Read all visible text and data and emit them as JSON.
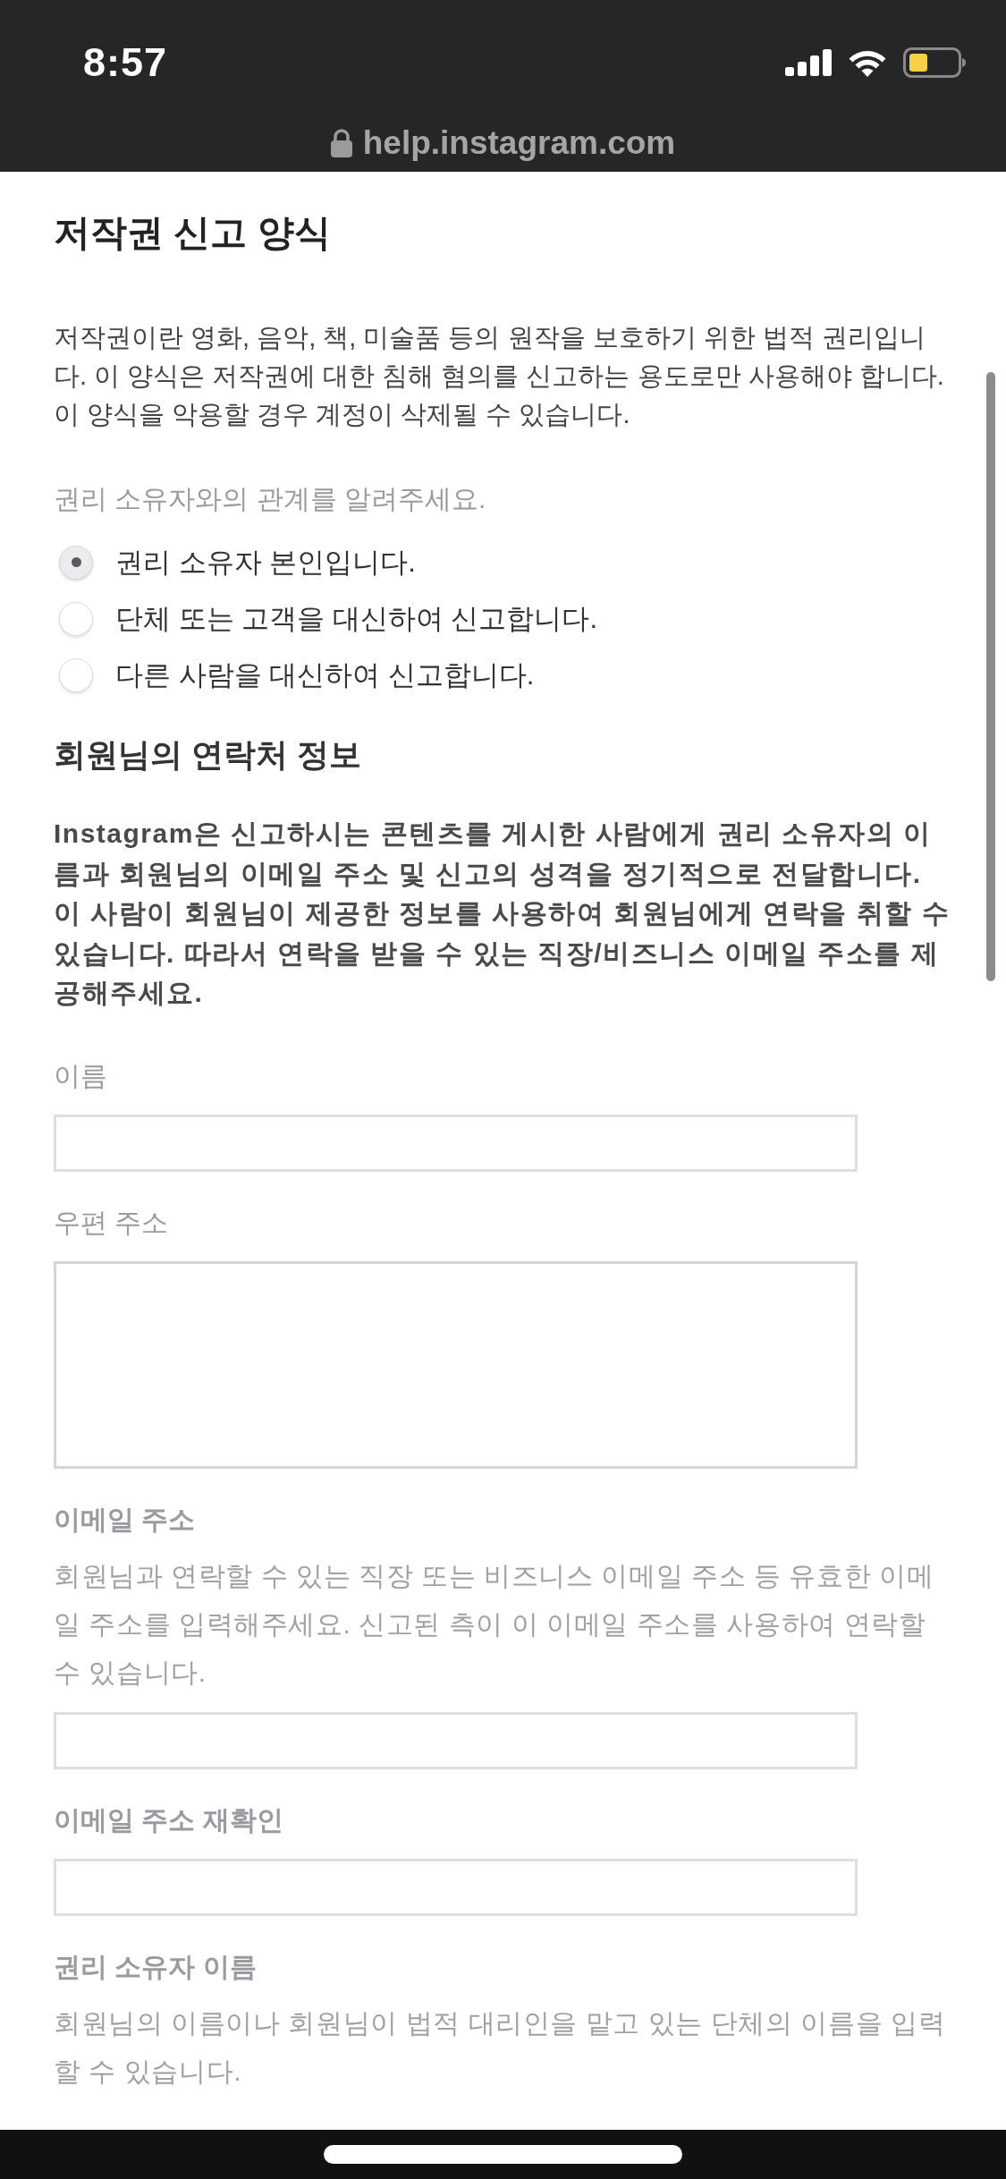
{
  "status_bar": {
    "time": "8:57"
  },
  "address_bar": {
    "url": "help.instagram.com"
  },
  "form": {
    "title": "저작권 신고 양식",
    "intro": "저작권이란 영화, 음악, 책, 미술품 등의 원작을 보호하기 위한 법적 권리입니다. 이 양식은 저작권에 대한 침해 혐의를 신고하는 용도로만 사용해야 합니다. 이 양식을 악용할 경우 계정이 삭제될 수 있습니다.",
    "relationship": {
      "label": "권리 소유자와의 관계를 알려주세요.",
      "options": [
        {
          "label": "권리 소유자 본인입니다.",
          "selected": true
        },
        {
          "label": "단체 또는 고객을 대신하여 신고합니다.",
          "selected": false
        },
        {
          "label": "다른 사람을 대신하여 신고합니다.",
          "selected": false
        }
      ]
    },
    "contact": {
      "heading": "회원님의 연락처 정보",
      "description": "**Instagram**은 신고하시는 콘텐츠를 게시한 사람에게 권리 소유자의 이름과 회원님의 이메일 주소 및 신고의 성격을 정기적으로 전달합니다. 이 사람이 회원님이 제공한 정보를 사용하여 회원님에게 연락을 취할 수 있습니다. 따라서 연락을 받을 수 있는 직장/비즈니스 이메일 주소를 제공해주세요."
    },
    "fields": [
      {
        "label": "이름",
        "label_bold": false,
        "kind": "input"
      },
      {
        "label": "우편 주소",
        "label_bold": false,
        "kind": "textarea"
      },
      {
        "label": "이메일 주소",
        "label_bold": true,
        "help": "회원님과 연락할 수 있는 직장 또는 비즈니스 이메일 주소 등 유효한 이메일 주소를 입력해주세요. 신고된 측이 이 이메일 주소를 사용하여 연락할 수 있습니다.",
        "kind": "input"
      },
      {
        "label": "이메일 주소 재확인",
        "label_bold": true,
        "kind": "input"
      },
      {
        "label": "권리 소유자 이름",
        "label_bold": true,
        "help": "회원님의 이름이나 회원님이 법적 대리인을 맡고 있는 단체의 이름을 입력할 수 있습니다.",
        "kind": "text"
      }
    ]
  }
}
